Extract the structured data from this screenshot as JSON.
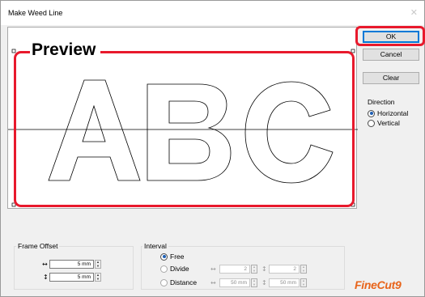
{
  "window": {
    "title": "Make Weed Line",
    "close_icon": "close-icon"
  },
  "preview": {
    "label": "Preview",
    "letters": "ABC"
  },
  "buttons": {
    "ok": "OK",
    "cancel": "Cancel",
    "clear": "Clear"
  },
  "direction": {
    "label": "Direction",
    "options": [
      {
        "label": "Horizontal",
        "selected": true
      },
      {
        "label": "Vertical",
        "selected": false
      }
    ]
  },
  "frame_offset": {
    "title": "Frame Offset",
    "horizontal": {
      "icon": "horizontal-arrows-icon",
      "value": "5 mm"
    },
    "vertical": {
      "icon": "vertical-arrows-icon",
      "value": "5 mm"
    }
  },
  "interval": {
    "title": "Interval",
    "free": {
      "label": "Free",
      "selected": true
    },
    "divide": {
      "label": "Divide",
      "selected": false,
      "horizontal": "2",
      "vertical": "2"
    },
    "distance": {
      "label": "Distance",
      "selected": false,
      "horizontal": "50 mm",
      "vertical": "50 mm"
    }
  },
  "logo": {
    "text": "FineCut9",
    "color": "#e8641a"
  },
  "colors": {
    "highlight": "#e8192c",
    "accent": "#0078d7"
  }
}
